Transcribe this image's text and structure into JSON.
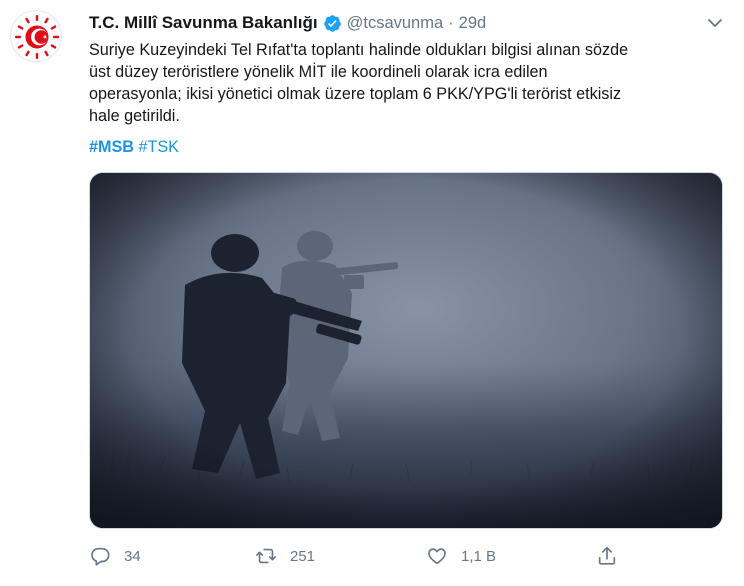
{
  "account": {
    "display_name": "T.C. Millî Savunma Bakanlığı",
    "handle": "@tcsavunma",
    "separator": "·",
    "time": "29d",
    "verified": true,
    "avatar_icon": "ministry-emblem-icon"
  },
  "tweet": {
    "lines": [
      "Suriye Kuzeyindeki Tel Rıfat'ta toplantı halinde oldukları bilgisi alınan sözde",
      "üst düzey teröristlere yönelik MİT ile koordineli olarak icra edilen",
      "operasyonla; ikisi yönetici olmak üzere toplam 6 PKK/YPG'li terörist etkisiz",
      "hale getirildi."
    ],
    "hashtags": [
      "#MSB",
      "#TSK"
    ]
  },
  "actions": {
    "reply": {
      "icon": "reply-icon",
      "count": "34"
    },
    "retweet": {
      "icon": "retweet-icon",
      "count": "251"
    },
    "like": {
      "icon": "heart-icon",
      "count": "1,1 B"
    },
    "share": {
      "icon": "share-icon"
    }
  },
  "colors": {
    "accent": "#1b95e0",
    "verified": "#1da1f2",
    "muted": "#657786",
    "emblem_red": "#e30a17"
  }
}
